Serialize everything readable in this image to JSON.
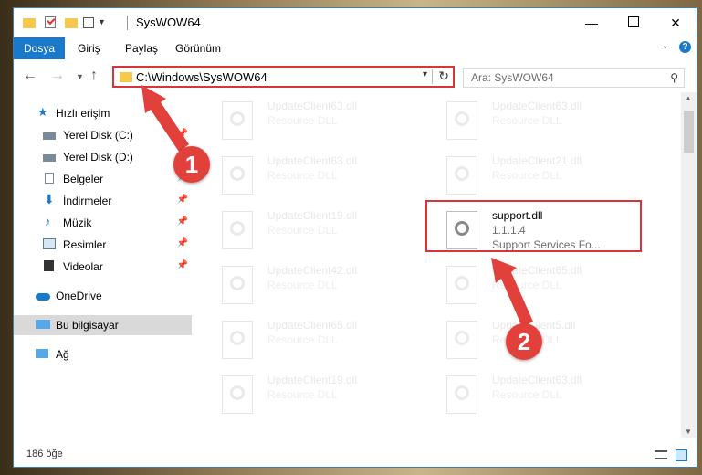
{
  "window": {
    "title": "SysWOW64"
  },
  "ribbon": {
    "tabs": [
      "Dosya",
      "Giriş",
      "Paylaş",
      "Görünüm"
    ]
  },
  "address": {
    "path": "C:\\Windows\\SysWOW64"
  },
  "search": {
    "placeholder": "Ara: SysWOW64"
  },
  "sidebar": {
    "items": [
      {
        "label": "Hızlı erişim",
        "icon": "star-icon"
      },
      {
        "label": "Yerel Disk (C:)",
        "icon": "drive-icon"
      },
      {
        "label": "Yerel Disk (D:)",
        "icon": "drive-icon"
      },
      {
        "label": "Belgeler",
        "icon": "documents-icon"
      },
      {
        "label": "İndirmeler",
        "icon": "download-arrow-icon"
      },
      {
        "label": "Müzik",
        "icon": "music-note-icon"
      },
      {
        "label": "Resimler",
        "icon": "pictures-icon"
      },
      {
        "label": "Videolar",
        "icon": "film-icon"
      },
      {
        "label": "OneDrive",
        "icon": "cloud-icon"
      },
      {
        "label": "Bu bilgisayar",
        "icon": "computer-icon"
      },
      {
        "label": "Ağ",
        "icon": "network-icon"
      }
    ]
  },
  "files": [
    {
      "name": "UpdateClient63.dll",
      "type": "Resource DLL"
    },
    {
      "name": "UpdateClient63.dll",
      "type": "Resource DLL"
    },
    {
      "name": "UpdateClient63.dll",
      "type": "Resource DLL"
    },
    {
      "name": "UpdateClient21.dll",
      "type": "Resource DLL"
    },
    {
      "name": "UpdateClient19.dll",
      "type": "Resource DLL"
    },
    {
      "name": "support.dll",
      "version": "1.1.1.4",
      "desc": "Support Services Fo..."
    },
    {
      "name": "UpdateClient42.dll",
      "type": "Resource DLL"
    },
    {
      "name": "UpdateClient65.dll",
      "type": "Resource DLL"
    },
    {
      "name": "UpdateClient65.dll",
      "type": "Resource DLL"
    },
    {
      "name": "UpdateClient5.dll",
      "type": "Resource DLL"
    },
    {
      "name": "UpdateClient19.dll",
      "type": "Resource DLL"
    },
    {
      "name": "UpdateClient63.dll",
      "type": "Resource DLL"
    }
  ],
  "status": {
    "count": "186 öğe"
  },
  "annotations": {
    "badge1": "1",
    "badge2": "2",
    "color": "#e2413b"
  }
}
